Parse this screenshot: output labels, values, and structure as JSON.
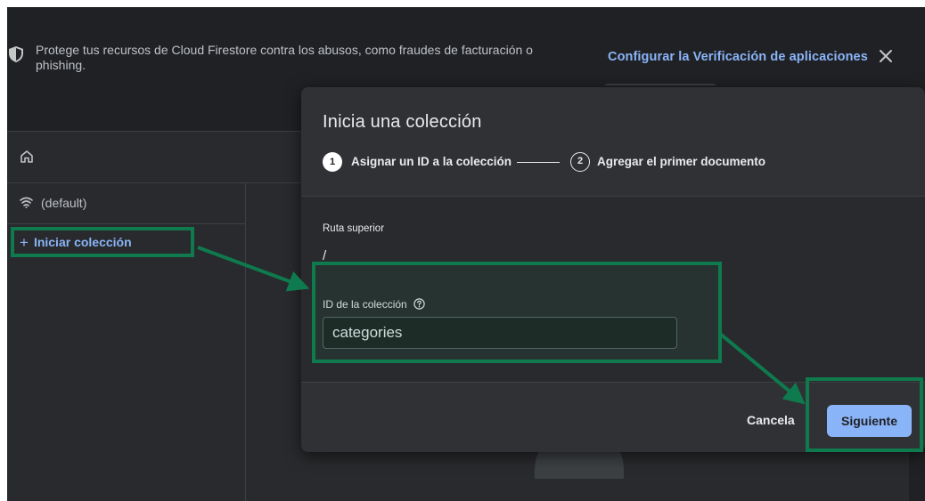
{
  "banner": {
    "message": "Protege tus recursos de Cloud Firestore contra los abusos, como fraudes de facturación o phishing.",
    "link_label": "Configurar la Verificación de aplicaciones",
    "icons": {
      "shield": "shield-icon",
      "close": "close-icon"
    }
  },
  "nav": {
    "home_icon": "home-icon",
    "database_label": "(default)",
    "database_icon": "database-icon",
    "start_collection_label": "Iniciar colección",
    "start_collection_icon": "plus-icon"
  },
  "dialog": {
    "title": "Inicia una colección",
    "steps": [
      {
        "number": "1",
        "label": "Asignar un ID a la colección",
        "state": "active"
      },
      {
        "number": "2",
        "label": "Agregar el primer documento",
        "state": "inactive"
      }
    ],
    "parent_path_label": "Ruta superior",
    "parent_path_value": "/",
    "collection_id_label": "ID de la colección",
    "collection_id_help_icon": "help-circle-icon",
    "collection_id_value": "categories",
    "cancel_label": "Cancela",
    "next_label": "Siguiente"
  },
  "colors": {
    "accent": "#8ab4f8",
    "background": "#202124",
    "surface": "#303134",
    "highlight": "#0e7a4d"
  }
}
